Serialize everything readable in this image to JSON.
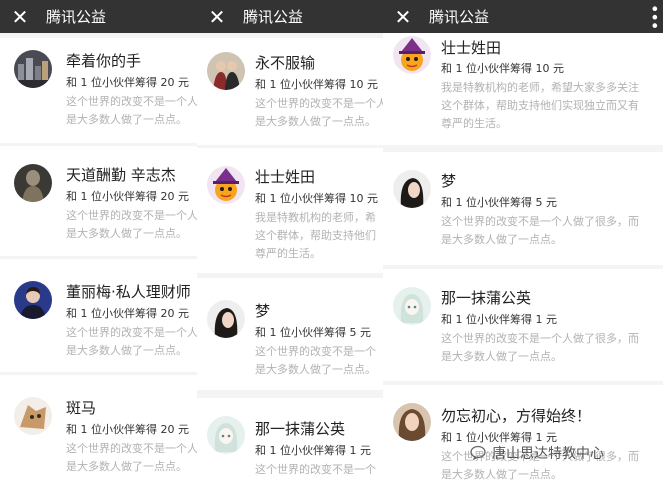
{
  "panels": [
    {
      "title": "腾讯公益",
      "items": [
        {
          "name": "牵着你的手",
          "amount": "和 1 位小伙伴筹得 20 元",
          "msg1": "这个世界的改变不是一个人",
          "msg2": "是大多数人做了一点点。",
          "avatar": "city-photo-avatar"
        },
        {
          "name": "天道酬勤 辛志杰",
          "amount": "和 1 位小伙伴筹得 20 元",
          "msg1": "这个世界的改变不是一个人",
          "msg2": "是大多数人做了一点点。",
          "avatar": "statue-photo-avatar"
        },
        {
          "name": "董丽梅·私人理财师",
          "amount": "和 1 位小伙伴筹得 20 元",
          "msg1": "这个世界的改变不是一个人",
          "msg2": "是大多数人做了一点点。",
          "avatar": "portrait-photo-avatar"
        },
        {
          "name": "斑马",
          "amount": "和 1 位小伙伴筹得 20 元",
          "msg1": "这个世界的改变不是一个人",
          "msg2": "是大多数人做了一点点。",
          "avatar": "cartoon-bear-avatar"
        }
      ]
    },
    {
      "title": "腾讯公益",
      "items": [
        {
          "name": "永不服输",
          "amount": "和 1 位小伙伴筹得 10 元",
          "msg1": "这个世界的改变不是一个人",
          "msg2": "是大多数人做了一点点。",
          "avatar": "couple-photo-avatar"
        },
        {
          "name": "壮士姓田",
          "amount": "和 1 位小伙伴筹得 10 元",
          "msg1": "我是特教机构的老师，希",
          "msg2": "这个群体，帮助支持他们",
          "msg3": "尊严的生活。",
          "avatar": "witch-cartoon-avatar"
        },
        {
          "name": "梦",
          "amount": "和 1 位小伙伴筹得 5 元",
          "msg1": "这个世界的改变不是一个",
          "msg2": "是大多数人做了一点点。",
          "avatar": "girl-photo-avatar"
        },
        {
          "name": "那一抹蒲公英",
          "amount": "和 1 位小伙伴筹得 1 元",
          "msg1": "这个世界的改变不是一个",
          "msg2": "",
          "avatar": "anime-girl-avatar"
        }
      ]
    },
    {
      "title": "腾讯公益",
      "items": [
        {
          "name": "壮士姓田",
          "amount": "和 1 位小伙伴筹得 10 元",
          "msg1": "我是特教机构的老师，希望大家多多关注",
          "msg2": "这个群体，帮助支持他们实现独立而又有",
          "msg3": "尊严的生活。",
          "avatar": "witch-cartoon-avatar"
        },
        {
          "name": "梦",
          "amount": "和 1 位小伙伴筹得 5 元",
          "msg1": "这个世界的改变不是一个人做了很多，而",
          "msg2": "是大多数人做了一点点。",
          "avatar": "girl-photo-avatar"
        },
        {
          "name": "那一抹蒲公英",
          "amount": "和 1 位小伙伴筹得 1 元",
          "msg1": "这个世界的改变不是一个人做了很多，而",
          "msg2": "是大多数人做了一点点。",
          "avatar": "anime-girl-avatar"
        },
        {
          "name": "勿忘初心，方得始终！",
          "amount": "和 1 位小伙伴筹得 1 元",
          "msg1": "这个世界的改变不是一个人做了很多，而",
          "msg2": "是大多数人做了一点点。",
          "avatar": "woman-photo-avatar"
        }
      ]
    }
  ],
  "watermark": "唐山思达特教中心",
  "icons": {
    "close": "close-icon",
    "more": "more-icon"
  }
}
